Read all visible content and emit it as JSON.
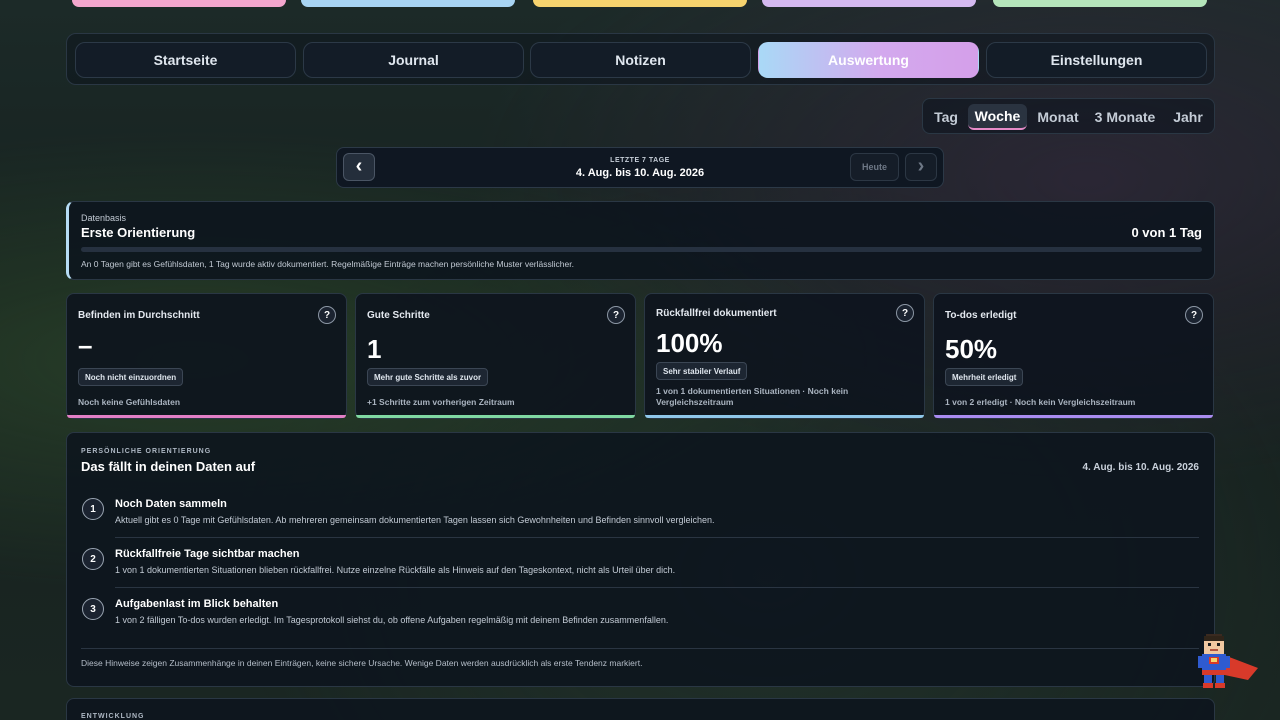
{
  "nav": {
    "tabs": [
      {
        "label": "Startseite"
      },
      {
        "label": "Journal"
      },
      {
        "label": "Notizen"
      },
      {
        "label": "Auswertung"
      },
      {
        "label": "Einstellungen"
      }
    ],
    "active_tab": "Auswertung"
  },
  "ranges": {
    "items": [
      "Tag",
      "Woche",
      "Monat",
      "3 Monate",
      "Jahr"
    ],
    "active": "Woche"
  },
  "date_nav": {
    "prev_icon": "‹",
    "next_icon": "›",
    "eyebrow": "LETZTE 7 TAGE",
    "range": "4. Aug. bis 10. Aug. 2026",
    "today_label": "Heute"
  },
  "database": {
    "label": "Datenbasis",
    "title": "Erste Orientierung",
    "count": "0 von 1 Tag",
    "progress": 0,
    "note": "An 0 Tagen gibt es Gefühlsdaten, 1 Tag wurde aktiv dokumentiert. Regelmäßige Einträge machen persönliche Muster verlässlicher."
  },
  "kpis": [
    {
      "title": "Befinden im Durchschnitt",
      "value": "–",
      "badge": "Noch nicht einzuordnen",
      "foot": "Noch keine Gefühlsdaten",
      "bar_color": "#e27fc6"
    },
    {
      "title": "Gute Schritte",
      "value": "1",
      "badge": "Mehr gute Schritte als zuvor",
      "foot": "+1 Schritte zum vorherigen Zeitraum",
      "bar_color": "#7fd8a2"
    },
    {
      "title": "Rückfallfrei dokumentiert",
      "value": "100%",
      "badge": "Sehr stabiler Verlauf",
      "foot": "1 von 1 dokumentierten Situationen · Noch kein Vergleichszeitraum",
      "bar_color": "#8fc7ea"
    },
    {
      "title": "To-dos erledigt",
      "value": "50%",
      "badge": "Mehrheit erledigt",
      "foot": "1 von 2 erledigt · Noch kein Vergleichszeitraum",
      "bar_color": "#a98cf0"
    }
  ],
  "help_icon": "?",
  "insights": {
    "eyebrow": "PERSÖNLICHE ORIENTIERUNG",
    "title": "Das fällt in deinen Daten auf",
    "range": "4. Aug. bis 10. Aug. 2026",
    "items": [
      {
        "num": "1",
        "title": "Noch Daten sammeln",
        "text": "Aktuell gibt es 0 Tage mit Gefühlsdaten. Ab mehreren gemeinsam dokumentierten Tagen lassen sich Gewohnheiten und Befinden sinnvoll vergleichen."
      },
      {
        "num": "2",
        "title": "Rückfallfreie Tage sichtbar machen",
        "text": "1 von 1 dokumentierten Situationen blieben rückfallfrei. Nutze einzelne Rückfälle als Hinweis auf den Tageskontext, nicht als Urteil über dich."
      },
      {
        "num": "3",
        "title": "Aufgabenlast im Blick behalten",
        "text": "1 von 2 fälligen To-dos wurden erledigt. Im Tagesprotokoll siehst du, ob offene Aufgaben regelmäßig mit deinem Befinden zusammenfallen."
      }
    ],
    "footnote": "Diese Hinweise zeigen Zusammenhänge in deinen Einträgen, keine sichere Ursache. Wenige Daten werden ausdrücklich als erste Tendenz markiert."
  },
  "development": {
    "eyebrow": "ENTWICKLUNG"
  },
  "colors": {
    "accent_pink": "#e27fc6",
    "accent_blue": "#a9d9f6",
    "card_bg": "#0d141e"
  }
}
